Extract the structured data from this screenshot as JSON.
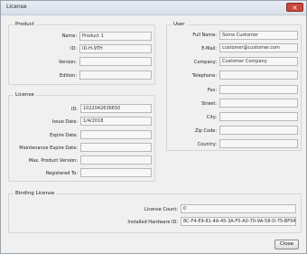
{
  "window": {
    "title": "License",
    "close_glyph": "✕"
  },
  "product": {
    "title": "Product",
    "fields": [
      {
        "label": "Name:",
        "value": "Product 1"
      },
      {
        "label": "ID:",
        "value": "ID-H-9TH"
      },
      {
        "label": "Version:",
        "value": ""
      },
      {
        "label": "Edition:",
        "value": ""
      }
    ]
  },
  "user": {
    "title": "User",
    "fields": [
      {
        "label": "Full Name:",
        "value": "Some Customer"
      },
      {
        "label": "E-Mail:",
        "value": "customer@customer.com"
      },
      {
        "label": "Company:",
        "value": "Customer Company"
      },
      {
        "label": "Telephone:",
        "value": ""
      },
      {
        "label": "Fax:",
        "value": ""
      },
      {
        "label": "Street:",
        "value": ""
      },
      {
        "label": "City:",
        "value": ""
      },
      {
        "label": "Zip Code:",
        "value": ""
      },
      {
        "label": "Country:",
        "value": ""
      }
    ]
  },
  "license": {
    "title": "License",
    "fields": [
      {
        "label": "ID:",
        "value": "1022042636650"
      },
      {
        "label": "Issue Date:",
        "value": "1/4/2018"
      },
      {
        "label": "Expire Date:",
        "value": ""
      },
      {
        "label": "Maintenance Expire Date:",
        "value": ""
      },
      {
        "label": "Max. Product Version:",
        "value": ""
      },
      {
        "label": "Registered To:",
        "value": ""
      }
    ]
  },
  "binding": {
    "title": "Binding License",
    "fields": [
      {
        "label": "License Count:",
        "value": "0"
      },
      {
        "label": "Installed Hardware ID:",
        "value": "8C-F4-E9-81-4A-45-3A-F5-A0-70-9A-58-D-75-BF94"
      }
    ]
  },
  "footer": {
    "close_label": "Close"
  }
}
